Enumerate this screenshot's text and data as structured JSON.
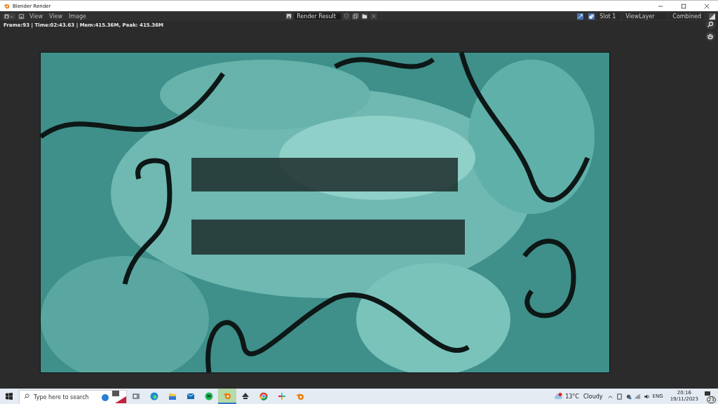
{
  "window": {
    "title": "Blender Render"
  },
  "header": {
    "menus": [
      "View",
      "View",
      "Image"
    ],
    "image_name": "Render Result",
    "slot": "Slot 1",
    "view_layer": "ViewLayer",
    "pass": "Combined"
  },
  "status_line": "Frame:93 | Time:02:43.63 | Mem:415.36M, Peak: 415.36M",
  "taskbar": {
    "search_placeholder": "Type here to search",
    "apps": [
      {
        "kind": "taskview",
        "selected": false
      },
      {
        "kind": "edge",
        "selected": false
      },
      {
        "kind": "explorer",
        "selected": false
      },
      {
        "kind": "mail",
        "selected": false
      },
      {
        "kind": "spotify",
        "selected": false
      },
      {
        "kind": "blender",
        "selected": true
      },
      {
        "kind": "inkscape",
        "selected": false
      },
      {
        "kind": "chrome",
        "selected": false
      },
      {
        "kind": "slack",
        "selected": false
      },
      {
        "kind": "blender",
        "selected": false
      }
    ],
    "weather": {
      "temperature": "13°C",
      "condition": "Cloudy"
    },
    "language": "ENG",
    "time": "20:16",
    "date": "19/11/2023",
    "notifications": "23"
  }
}
